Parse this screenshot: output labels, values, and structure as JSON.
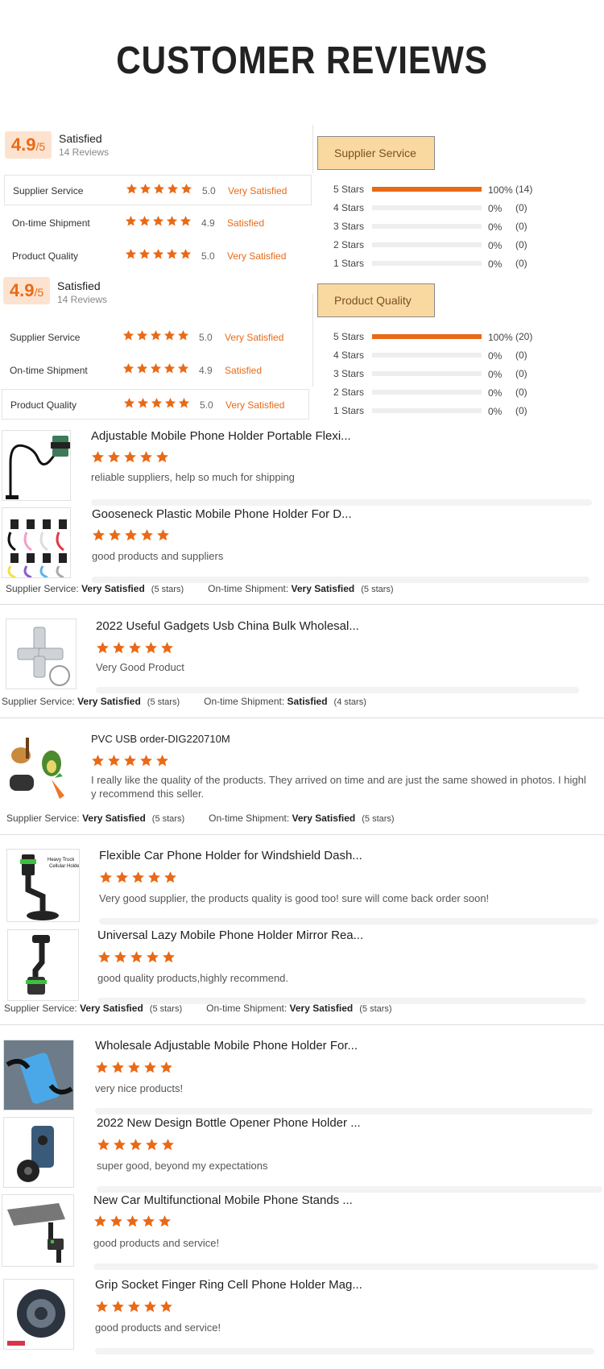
{
  "title": "CUSTOMER REVIEWS",
  "brand_color": "#e96a16",
  "summaries": [
    {
      "score": "4.9",
      "score_suffix": "/5",
      "status": "Satisfied",
      "review_count": "14 Reviews",
      "ratings": [
        {
          "label": "Supplier Service",
          "score": "5.0",
          "text": "Very Satisfied",
          "stars": 5
        },
        {
          "label": "On-time Shipment",
          "score": "4.9",
          "text": "Satisfied",
          "stars": 5
        },
        {
          "label": "Product Quality",
          "score": "5.0",
          "text": "Very Satisfied",
          "stars": 5
        }
      ],
      "dimension": "Supplier Service",
      "distribution": [
        {
          "label": "5  Stars",
          "percent": 100,
          "pct_text": "100%",
          "count": "(14)"
        },
        {
          "label": "4  Stars",
          "percent": 0,
          "pct_text": "0%",
          "count": "(0)"
        },
        {
          "label": "3  Stars",
          "percent": 0,
          "pct_text": "0%",
          "count": "(0)"
        },
        {
          "label": "2  Stars",
          "percent": 0,
          "pct_text": "0%",
          "count": "(0)"
        },
        {
          "label": "1  Stars",
          "percent": 0,
          "pct_text": "0%",
          "count": "(0)"
        }
      ]
    },
    {
      "score": "4.9",
      "score_suffix": "/5",
      "status": "Satisfied",
      "review_count": "14 Reviews",
      "ratings": [
        {
          "label": "Supplier Service",
          "score": "5.0",
          "text": "Very Satisfied",
          "stars": 5
        },
        {
          "label": "On-time Shipment",
          "score": "4.9",
          "text": "Satisfied",
          "stars": 5
        },
        {
          "label": "Product Quality",
          "score": "5.0",
          "text": "Very Satisfied",
          "stars": 5
        }
      ],
      "dimension": "Product Quality",
      "distribution": [
        {
          "label": "5  Stars",
          "percent": 100,
          "pct_text": "100%",
          "count": "(20)"
        },
        {
          "label": "4  Stars",
          "percent": 0,
          "pct_text": "0%",
          "count": "(0)"
        },
        {
          "label": "3  Stars",
          "percent": 0,
          "pct_text": "0%",
          "count": "(0)"
        },
        {
          "label": "2  Stars",
          "percent": 0,
          "pct_text": "0%",
          "count": "(0)"
        },
        {
          "label": "1  Stars",
          "percent": 0,
          "pct_text": "0%",
          "count": "(0)"
        }
      ]
    }
  ],
  "reviews": [
    {
      "product": "Adjustable Mobile Phone Holder Portable Flexi...",
      "stars": 5,
      "text": "reliable suppliers, help so much for shipping",
      "image": "gooseneck-holder"
    },
    {
      "product": "Gooseneck Plastic Mobile Phone Holder For D...",
      "stars": 5,
      "text": "good products and suppliers",
      "image": "colorful-neck-holders"
    },
    {
      "product": "2022 Useful Gadgets Usb China Bulk Wholesal...",
      "stars": 5,
      "text": "Very Good Product",
      "image": "usb-adapter"
    },
    {
      "product": "PVC USB order-DIG220710M",
      "stars": 5,
      "text": "I really like the quality of the products. They arrived on time and are just the same showed in photos. I highl",
      "text2": "y recommend this seller.",
      "image": "pvc-usb-figures"
    },
    {
      "product": "Flexible Car Phone Holder for Windshield Dash...",
      "stars": 5,
      "text": "Very good supplier, the products quality is good too! sure will come back order soon!",
      "image": "car-windshield-holder",
      "image_caption": "Heavy Truck Cellular Holder"
    },
    {
      "product": "Universal Lazy Mobile Phone Holder Mirror Rea...",
      "stars": 5,
      "text": "good quality products,highly recommend.",
      "image": "mirror-holder"
    },
    {
      "product": "Wholesale Adjustable Mobile Phone Holder For...",
      "stars": 5,
      "text": "very nice products!",
      "image": "bike-phone-holder"
    },
    {
      "product": "2022 New Design Bottle Opener Phone Holder ...",
      "stars": 5,
      "text": "super good, beyond my expectations",
      "image": "bottle-opener-holder"
    },
    {
      "product": "New Car Multifunctional Mobile Phone Stands ...",
      "stars": 5,
      "text": "good products and service!",
      "image": "car-stand"
    },
    {
      "product": "Grip Socket Finger Ring Cell Phone Holder Mag...",
      "stars": 5,
      "text": "good products and service!",
      "image": "ring-holder"
    }
  ],
  "meta": [
    {
      "supplier_label": "Supplier Service:",
      "supplier_value": "Very Satisfied",
      "supplier_stars": "(5 stars)",
      "shipment_label": "On-time Shipment:",
      "shipment_value": "Very Satisfied",
      "shipment_stars": "(5 stars)"
    },
    {
      "supplier_label": "Supplier Service:",
      "supplier_value": "Very Satisfied",
      "supplier_stars": "(5 stars)",
      "shipment_label": "On-time Shipment:",
      "shipment_value": "Satisfied",
      "shipment_stars": "(4 stars)"
    },
    {
      "supplier_label": "Supplier Service:",
      "supplier_value": "Very Satisfied",
      "supplier_stars": "(5 stars)",
      "shipment_label": "On-time Shipment:",
      "shipment_value": "Very Satisfied",
      "shipment_stars": "(5 stars)"
    },
    {
      "supplier_label": "Supplier Service:",
      "supplier_value": "Very Satisfied",
      "supplier_stars": "(5 stars)",
      "shipment_label": "On-time Shipment:",
      "shipment_value": "Very Satisfied",
      "shipment_stars": "(5 stars)"
    }
  ]
}
